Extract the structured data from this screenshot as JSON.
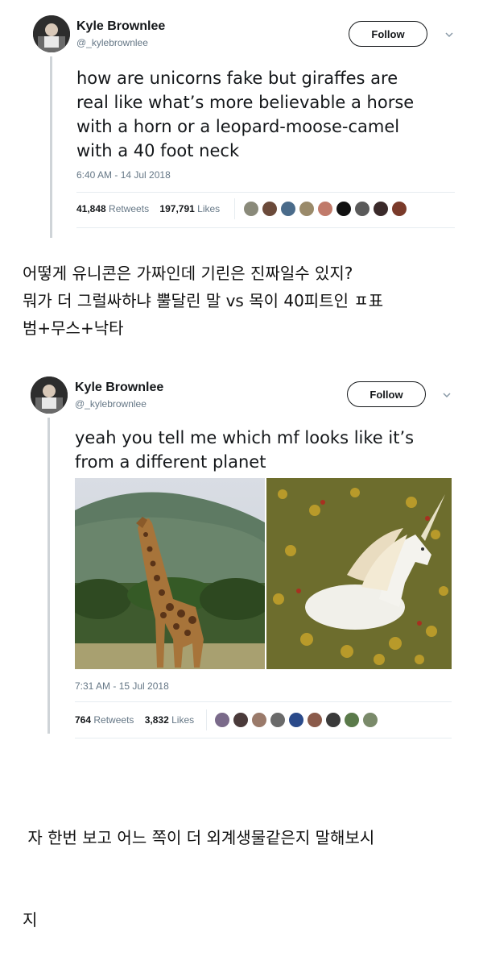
{
  "tweet1": {
    "author_name": "Kyle Brownlee",
    "author_handle": "@_kylebrownlee",
    "follow_label": "Follow",
    "text_lines": [
      "how are unicorns fake but giraffes are",
      "real like what’s more believable a horse",
      "with a horn or a leopard-moose-camel",
      "with a 40 foot neck"
    ],
    "timestamp": "6:40 AM - 14 Jul 2018",
    "retweets_count": "41,848",
    "retweets_label": "Retweets",
    "likes_count": "197,791",
    "likes_label": "Likes",
    "liker_avatar_colors": [
      "#8a8a7a",
      "#6b4a3a",
      "#4a6b8a",
      "#9a8a6a",
      "#c07a6a",
      "#111111",
      "#5a5a5a",
      "#3a2a2a",
      "#7a3a2a"
    ]
  },
  "caption1_lines": [
    "어떻게 유니콘은 가짜인데 기린은 진짜일수 있지?",
    "뭐가 더 그럴싸하냐 뿔달린 말 vs 목이 40피트인 ㅍ표",
    "범+무스+낙타"
  ],
  "tweet2": {
    "author_name": "Kyle Brownlee",
    "author_handle": "@_kylebrownlee",
    "follow_label": "Follow",
    "text_lines": [
      "yeah you tell me which mf looks like it’s",
      "from a different planet"
    ],
    "photos": [
      "giraffe-photo",
      "unicorn-photo"
    ],
    "timestamp": "7:31 AM - 15 Jul 2018",
    "retweets_count": "764",
    "retweets_label": "Retweets",
    "likes_count": "3,832",
    "likes_label": "Likes",
    "liker_avatar_colors": [
      "#7a6a8a",
      "#4a3a3a",
      "#9a7a6a",
      "#6a6a6a",
      "#2a4a8a",
      "#8a5a4a",
      "#3a3a3a",
      "#5a7a4a",
      "#7a8a6a"
    ]
  },
  "caption2_lines": [
    " 자 한번 보고 어느 쪽이 더 외계생물같은지 말해보시",
    "지"
  ]
}
